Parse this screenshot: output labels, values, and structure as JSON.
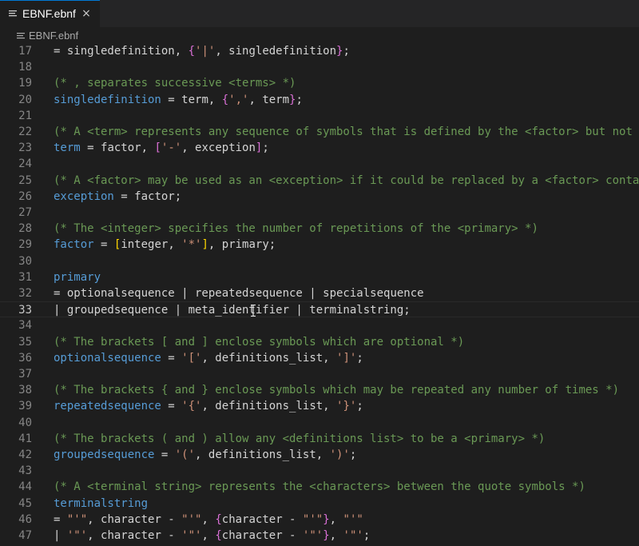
{
  "tab": {
    "label": "EBNF.ebnf",
    "close_glyph": "×"
  },
  "breadcrumb": {
    "label": "EBNF.ebnf"
  },
  "editor": {
    "current_line": "33",
    "lines": [
      {
        "n": "17",
        "tokens": [
          {
            "c": "t-op",
            "t": "= "
          },
          {
            "c": "t-tx",
            "t": "singledefinition, "
          },
          {
            "c": "t-bg",
            "t": "{"
          },
          {
            "c": "t-st",
            "t": "'|'"
          },
          {
            "c": "t-tx",
            "t": ", singledefinition"
          },
          {
            "c": "t-bg",
            "t": "}"
          },
          {
            "c": "t-tx",
            "t": ";"
          }
        ]
      },
      {
        "n": "18",
        "tokens": []
      },
      {
        "n": "19",
        "tokens": [
          {
            "c": "t-cm",
            "t": "(* , separates successive <terms> *)"
          }
        ]
      },
      {
        "n": "20",
        "tokens": [
          {
            "c": "t-id",
            "t": "singledefinition"
          },
          {
            "c": "t-op",
            "t": " = "
          },
          {
            "c": "t-tx",
            "t": "term, "
          },
          {
            "c": "t-bg",
            "t": "{"
          },
          {
            "c": "t-st",
            "t": "','"
          },
          {
            "c": "t-tx",
            "t": ", term"
          },
          {
            "c": "t-bg",
            "t": "}"
          },
          {
            "c": "t-tx",
            "t": ";"
          }
        ]
      },
      {
        "n": "21",
        "tokens": []
      },
      {
        "n": "22",
        "tokens": [
          {
            "c": "t-cm",
            "t": "(* A <term> represents any sequence of symbols that is defined by the <factor> but not def"
          }
        ]
      },
      {
        "n": "23",
        "tokens": [
          {
            "c": "t-id",
            "t": "term"
          },
          {
            "c": "t-op",
            "t": " = "
          },
          {
            "c": "t-tx",
            "t": "factor, "
          },
          {
            "c": "t-bg",
            "t": "["
          },
          {
            "c": "t-st",
            "t": "'-'"
          },
          {
            "c": "t-tx",
            "t": ", exception"
          },
          {
            "c": "t-bg",
            "t": "]"
          },
          {
            "c": "t-tx",
            "t": ";"
          }
        ]
      },
      {
        "n": "24",
        "tokens": []
      },
      {
        "n": "25",
        "tokens": [
          {
            "c": "t-cm",
            "t": "(* A <factor> may be used as an <exception> if it could be replaced by a <factor> containi"
          }
        ]
      },
      {
        "n": "26",
        "tokens": [
          {
            "c": "t-id",
            "t": "exception"
          },
          {
            "c": "t-op",
            "t": " = "
          },
          {
            "c": "t-tx",
            "t": "factor;"
          }
        ]
      },
      {
        "n": "27",
        "tokens": []
      },
      {
        "n": "28",
        "tokens": [
          {
            "c": "t-cm",
            "t": "(* The <integer> specifies the number of repetitions of the <primary> *)"
          }
        ]
      },
      {
        "n": "29",
        "tokens": [
          {
            "c": "t-id",
            "t": "factor"
          },
          {
            "c": "t-op",
            "t": " = "
          },
          {
            "c": "t-by",
            "t": "["
          },
          {
            "c": "t-tx",
            "t": "integer, "
          },
          {
            "c": "t-st",
            "t": "'*'"
          },
          {
            "c": "t-by",
            "t": "]"
          },
          {
            "c": "t-tx",
            "t": ", primary;"
          }
        ]
      },
      {
        "n": "30",
        "tokens": []
      },
      {
        "n": "31",
        "tokens": [
          {
            "c": "t-id",
            "t": "primary"
          }
        ]
      },
      {
        "n": "32",
        "tokens": [
          {
            "c": "t-op",
            "t": "= "
          },
          {
            "c": "t-tx",
            "t": "optionalsequence | repeatedsequence | specialsequence"
          }
        ]
      },
      {
        "n": "33",
        "tokens": [
          {
            "c": "t-tx",
            "t": "| groupedsequence | meta_identifier | terminalstring;"
          }
        ]
      },
      {
        "n": "34",
        "tokens": []
      },
      {
        "n": "35",
        "tokens": [
          {
            "c": "t-cm",
            "t": "(* The brackets [ and ] enclose symbols which are optional *)"
          }
        ]
      },
      {
        "n": "36",
        "tokens": [
          {
            "c": "t-id",
            "t": "optionalsequence"
          },
          {
            "c": "t-op",
            "t": " = "
          },
          {
            "c": "t-st",
            "t": "'['"
          },
          {
            "c": "t-tx",
            "t": ", definitions_list, "
          },
          {
            "c": "t-st",
            "t": "']'"
          },
          {
            "c": "t-tx",
            "t": ";"
          }
        ]
      },
      {
        "n": "37",
        "tokens": []
      },
      {
        "n": "38",
        "tokens": [
          {
            "c": "t-cm",
            "t": "(* The brackets { and } enclose symbols which may be repeated any number of times *)"
          }
        ]
      },
      {
        "n": "39",
        "tokens": [
          {
            "c": "t-id",
            "t": "repeatedsequence"
          },
          {
            "c": "t-op",
            "t": " = "
          },
          {
            "c": "t-st",
            "t": "'{'"
          },
          {
            "c": "t-tx",
            "t": ", definitions_list, "
          },
          {
            "c": "t-st",
            "t": "'}'"
          },
          {
            "c": "t-tx",
            "t": ";"
          }
        ]
      },
      {
        "n": "40",
        "tokens": []
      },
      {
        "n": "41",
        "tokens": [
          {
            "c": "t-cm",
            "t": "(* The brackets ( and ) allow any <definitions list> to be a <primary> *)"
          }
        ]
      },
      {
        "n": "42",
        "tokens": [
          {
            "c": "t-id",
            "t": "groupedsequence"
          },
          {
            "c": "t-op",
            "t": " = "
          },
          {
            "c": "t-st",
            "t": "'('"
          },
          {
            "c": "t-tx",
            "t": ", definitions_list, "
          },
          {
            "c": "t-st",
            "t": "')'"
          },
          {
            "c": "t-tx",
            "t": ";"
          }
        ]
      },
      {
        "n": "43",
        "tokens": []
      },
      {
        "n": "44",
        "tokens": [
          {
            "c": "t-cm",
            "t": "(* A <terminal string> represents the <characters> between the quote symbols *)"
          }
        ]
      },
      {
        "n": "45",
        "tokens": [
          {
            "c": "t-id",
            "t": "terminalstring"
          }
        ]
      },
      {
        "n": "46",
        "tokens": [
          {
            "c": "t-op",
            "t": "= "
          },
          {
            "c": "t-st",
            "t": "\"'\""
          },
          {
            "c": "t-tx",
            "t": ", character - "
          },
          {
            "c": "t-st",
            "t": "\"'\""
          },
          {
            "c": "t-tx",
            "t": ", "
          },
          {
            "c": "t-bg",
            "t": "{"
          },
          {
            "c": "t-tx",
            "t": "character - "
          },
          {
            "c": "t-st",
            "t": "\"'\""
          },
          {
            "c": "t-bg",
            "t": "}"
          },
          {
            "c": "t-tx",
            "t": ", "
          },
          {
            "c": "t-st",
            "t": "\"'\""
          }
        ]
      },
      {
        "n": "47",
        "tokens": [
          {
            "c": "t-op",
            "t": "| "
          },
          {
            "c": "t-st",
            "t": "'\"'"
          },
          {
            "c": "t-tx",
            "t": ", character - "
          },
          {
            "c": "t-st",
            "t": "'\"'"
          },
          {
            "c": "t-tx",
            "t": ", "
          },
          {
            "c": "t-bg",
            "t": "{"
          },
          {
            "c": "t-tx",
            "t": "character - "
          },
          {
            "c": "t-st",
            "t": "'\"'"
          },
          {
            "c": "t-bg",
            "t": "}"
          },
          {
            "c": "t-tx",
            "t": ", "
          },
          {
            "c": "t-st",
            "t": "'\"'"
          },
          {
            "c": "t-tx",
            "t": ";"
          }
        ]
      }
    ]
  },
  "colors": {
    "background": "#1e1e1e",
    "tabbar": "#252526",
    "identifier": "#569cd6",
    "comment": "#6a9955",
    "string": "#ce9178",
    "bracket_purple": "#da70d6",
    "bracket_gold": "#ffd700",
    "line_number": "#858585"
  },
  "icons": {
    "tab": "file-lines-icon",
    "breadcrumb": "file-lines-icon",
    "cursor": "text-cursor-icon"
  }
}
